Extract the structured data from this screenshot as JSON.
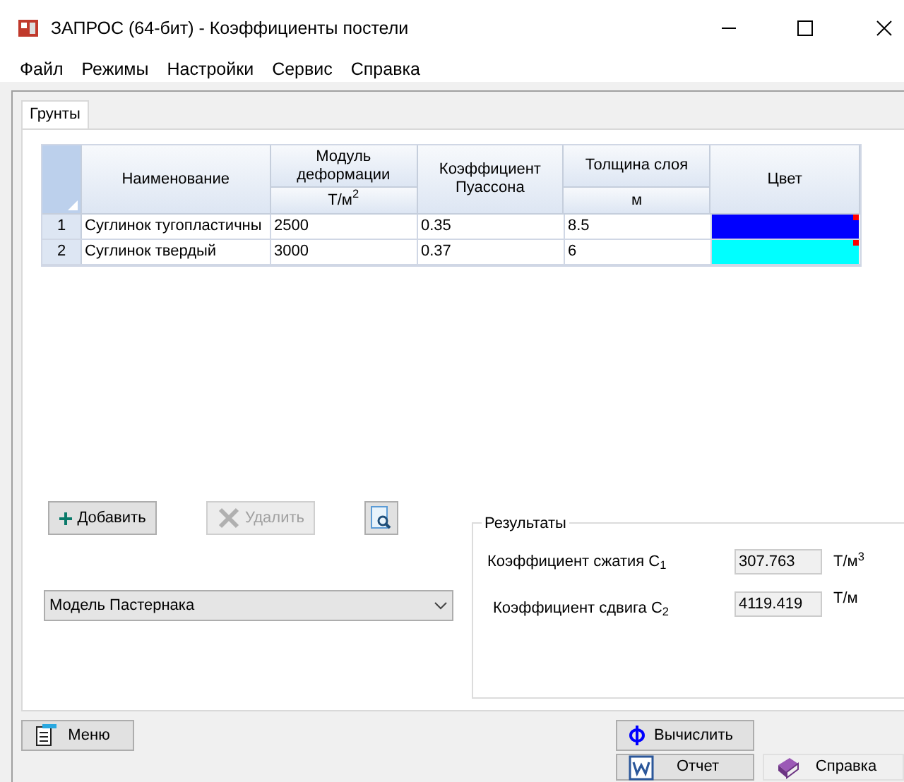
{
  "window": {
    "title": "ЗАПРОС (64-бит) - Коэффициенты постели"
  },
  "menu": [
    "Файл",
    "Режимы",
    "Настройки",
    "Сервис",
    "Справка"
  ],
  "tabs": [
    {
      "label": "Грунты",
      "selected": true
    }
  ],
  "table": {
    "columns": [
      {
        "label": "Наименование"
      },
      {
        "label": "Модуль деформации",
        "unit": "Т/м$^{2}$"
      },
      {
        "label": "Коэффициент Пуассона"
      },
      {
        "label": "Толщина слоя",
        "unit": "м"
      },
      {
        "label": "Цвет"
      }
    ],
    "rows": [
      {
        "number": "1",
        "name": "Суглинок тугопластичны",
        "modulus": "2500",
        "poisson": "0.35",
        "thickness": "8.5",
        "color": "#0000ff"
      },
      {
        "number": "2",
        "name": "Суглинок твердый",
        "modulus": "3000",
        "poisson": "0.37",
        "thickness": "6",
        "color": "#00ffff"
      }
    ]
  },
  "buttons": [
    {
      "kind": "add",
      "label": "Добавить",
      "disabled": false
    },
    {
      "kind": "delete",
      "label": "Удалить",
      "disabled": true
    },
    {
      "kind": "preview",
      "disabled": false
    }
  ],
  "model_select": {
    "value": "Модель Пастернака"
  },
  "results": {
    "title": "Результаты",
    "items": [
      {
        "label": "Коэффициент сжатия C$_{1}$",
        "value": "307.763",
        "unit": "Т/м$^{3}$"
      },
      {
        "label": "Коэффициент сдвига C$_{2}$",
        "value": "4119.419",
        "unit": "Т/м"
      }
    ]
  },
  "footer_buttons": [
    {
      "kind": "menu",
      "label": "Меню"
    },
    {
      "kind": "calculate",
      "label": "Вычислить"
    },
    {
      "kind": "report",
      "label": "Отчет"
    },
    {
      "kind": "help",
      "label": "Справка"
    }
  ]
}
